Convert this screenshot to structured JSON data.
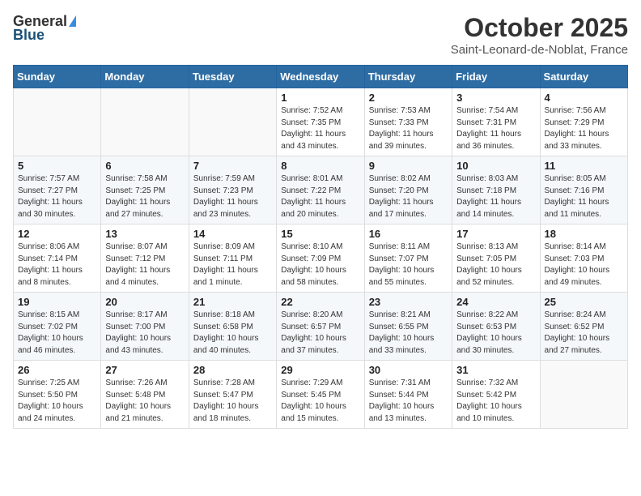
{
  "header": {
    "logo_general": "General",
    "logo_blue": "Blue",
    "month_title": "October 2025",
    "location": "Saint-Leonard-de-Noblat, France"
  },
  "weekdays": [
    "Sunday",
    "Monday",
    "Tuesday",
    "Wednesday",
    "Thursday",
    "Friday",
    "Saturday"
  ],
  "weeks": [
    [
      {
        "day": "",
        "info": ""
      },
      {
        "day": "",
        "info": ""
      },
      {
        "day": "",
        "info": ""
      },
      {
        "day": "1",
        "info": "Sunrise: 7:52 AM\nSunset: 7:35 PM\nDaylight: 11 hours\nand 43 minutes."
      },
      {
        "day": "2",
        "info": "Sunrise: 7:53 AM\nSunset: 7:33 PM\nDaylight: 11 hours\nand 39 minutes."
      },
      {
        "day": "3",
        "info": "Sunrise: 7:54 AM\nSunset: 7:31 PM\nDaylight: 11 hours\nand 36 minutes."
      },
      {
        "day": "4",
        "info": "Sunrise: 7:56 AM\nSunset: 7:29 PM\nDaylight: 11 hours\nand 33 minutes."
      }
    ],
    [
      {
        "day": "5",
        "info": "Sunrise: 7:57 AM\nSunset: 7:27 PM\nDaylight: 11 hours\nand 30 minutes."
      },
      {
        "day": "6",
        "info": "Sunrise: 7:58 AM\nSunset: 7:25 PM\nDaylight: 11 hours\nand 27 minutes."
      },
      {
        "day": "7",
        "info": "Sunrise: 7:59 AM\nSunset: 7:23 PM\nDaylight: 11 hours\nand 23 minutes."
      },
      {
        "day": "8",
        "info": "Sunrise: 8:01 AM\nSunset: 7:22 PM\nDaylight: 11 hours\nand 20 minutes."
      },
      {
        "day": "9",
        "info": "Sunrise: 8:02 AM\nSunset: 7:20 PM\nDaylight: 11 hours\nand 17 minutes."
      },
      {
        "day": "10",
        "info": "Sunrise: 8:03 AM\nSunset: 7:18 PM\nDaylight: 11 hours\nand 14 minutes."
      },
      {
        "day": "11",
        "info": "Sunrise: 8:05 AM\nSunset: 7:16 PM\nDaylight: 11 hours\nand 11 minutes."
      }
    ],
    [
      {
        "day": "12",
        "info": "Sunrise: 8:06 AM\nSunset: 7:14 PM\nDaylight: 11 hours\nand 8 minutes."
      },
      {
        "day": "13",
        "info": "Sunrise: 8:07 AM\nSunset: 7:12 PM\nDaylight: 11 hours\nand 4 minutes."
      },
      {
        "day": "14",
        "info": "Sunrise: 8:09 AM\nSunset: 7:11 PM\nDaylight: 11 hours\nand 1 minute."
      },
      {
        "day": "15",
        "info": "Sunrise: 8:10 AM\nSunset: 7:09 PM\nDaylight: 10 hours\nand 58 minutes."
      },
      {
        "day": "16",
        "info": "Sunrise: 8:11 AM\nSunset: 7:07 PM\nDaylight: 10 hours\nand 55 minutes."
      },
      {
        "day": "17",
        "info": "Sunrise: 8:13 AM\nSunset: 7:05 PM\nDaylight: 10 hours\nand 52 minutes."
      },
      {
        "day": "18",
        "info": "Sunrise: 8:14 AM\nSunset: 7:03 PM\nDaylight: 10 hours\nand 49 minutes."
      }
    ],
    [
      {
        "day": "19",
        "info": "Sunrise: 8:15 AM\nSunset: 7:02 PM\nDaylight: 10 hours\nand 46 minutes."
      },
      {
        "day": "20",
        "info": "Sunrise: 8:17 AM\nSunset: 7:00 PM\nDaylight: 10 hours\nand 43 minutes."
      },
      {
        "day": "21",
        "info": "Sunrise: 8:18 AM\nSunset: 6:58 PM\nDaylight: 10 hours\nand 40 minutes."
      },
      {
        "day": "22",
        "info": "Sunrise: 8:20 AM\nSunset: 6:57 PM\nDaylight: 10 hours\nand 37 minutes."
      },
      {
        "day": "23",
        "info": "Sunrise: 8:21 AM\nSunset: 6:55 PM\nDaylight: 10 hours\nand 33 minutes."
      },
      {
        "day": "24",
        "info": "Sunrise: 8:22 AM\nSunset: 6:53 PM\nDaylight: 10 hours\nand 30 minutes."
      },
      {
        "day": "25",
        "info": "Sunrise: 8:24 AM\nSunset: 6:52 PM\nDaylight: 10 hours\nand 27 minutes."
      }
    ],
    [
      {
        "day": "26",
        "info": "Sunrise: 7:25 AM\nSunset: 5:50 PM\nDaylight: 10 hours\nand 24 minutes."
      },
      {
        "day": "27",
        "info": "Sunrise: 7:26 AM\nSunset: 5:48 PM\nDaylight: 10 hours\nand 21 minutes."
      },
      {
        "day": "28",
        "info": "Sunrise: 7:28 AM\nSunset: 5:47 PM\nDaylight: 10 hours\nand 18 minutes."
      },
      {
        "day": "29",
        "info": "Sunrise: 7:29 AM\nSunset: 5:45 PM\nDaylight: 10 hours\nand 15 minutes."
      },
      {
        "day": "30",
        "info": "Sunrise: 7:31 AM\nSunset: 5:44 PM\nDaylight: 10 hours\nand 13 minutes."
      },
      {
        "day": "31",
        "info": "Sunrise: 7:32 AM\nSunset: 5:42 PM\nDaylight: 10 hours\nand 10 minutes."
      },
      {
        "day": "",
        "info": ""
      }
    ]
  ]
}
